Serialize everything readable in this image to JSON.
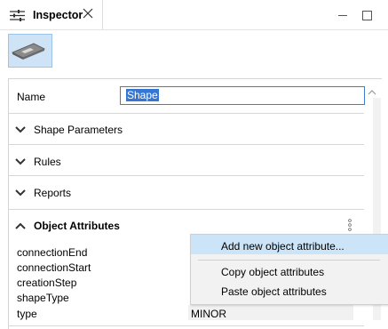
{
  "tab": {
    "title": "Inspector",
    "icon": "sliders-icon"
  },
  "toolbar": {
    "thumbnail": "shape-thumbnail-icon"
  },
  "name_field": {
    "label": "Name",
    "value": "Shape"
  },
  "sections": [
    {
      "label": "Shape Parameters",
      "expanded": false
    },
    {
      "label": "Rules",
      "expanded": false
    },
    {
      "label": "Reports",
      "expanded": false
    },
    {
      "label": "Object Attributes",
      "expanded": true
    }
  ],
  "attributes": [
    {
      "name": "connectionEnd",
      "value": ""
    },
    {
      "name": "connectionStart",
      "value": ""
    },
    {
      "name": "creationStep",
      "value": ""
    },
    {
      "name": "shapeType",
      "value": ""
    },
    {
      "name": "type",
      "value": "MINOR"
    }
  ],
  "context_menu": {
    "items": [
      {
        "label": "Add new object attribute...",
        "highlighted": true
      },
      {
        "label": "Copy object attributes",
        "highlighted": false
      },
      {
        "label": "Paste object attributes",
        "highlighted": false
      }
    ]
  },
  "colors": {
    "accent": "#3476d2",
    "selection": "#cce4f7",
    "thumbnail_bg": "#cfe3f6"
  }
}
